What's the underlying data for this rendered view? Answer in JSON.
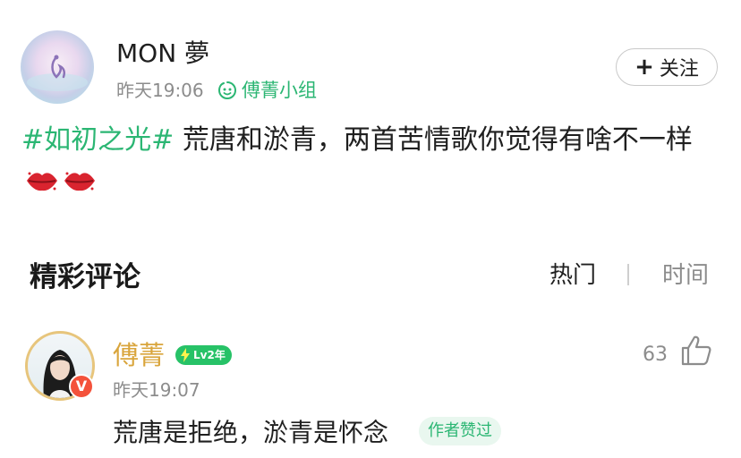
{
  "post": {
    "author": "MON 夢",
    "time": "昨天19:06",
    "group": "傅菁小组",
    "follow_label": "关注",
    "hashtag": "#如初之光#",
    "text": " 荒唐和淤青，两首苦情歌你觉得有啥不一样",
    "emojis": [
      "kiss-lips",
      "kiss-lips"
    ]
  },
  "comments_section": {
    "title": "精彩评论",
    "sort_options": [
      "热门",
      "时间"
    ],
    "active_sort": "热门"
  },
  "comment": {
    "author": "傅菁",
    "level_badge": "Lv2年",
    "verified_badge": "V",
    "time": "昨天19:07",
    "likes": "63",
    "text": "荒唐是拒绝，淤青是怀念",
    "author_liked_label": "作者赞过"
  },
  "colors": {
    "accent_green": "#2bb673",
    "commenter_gold": "#d9a53c",
    "verified_red": "#f4523b"
  }
}
